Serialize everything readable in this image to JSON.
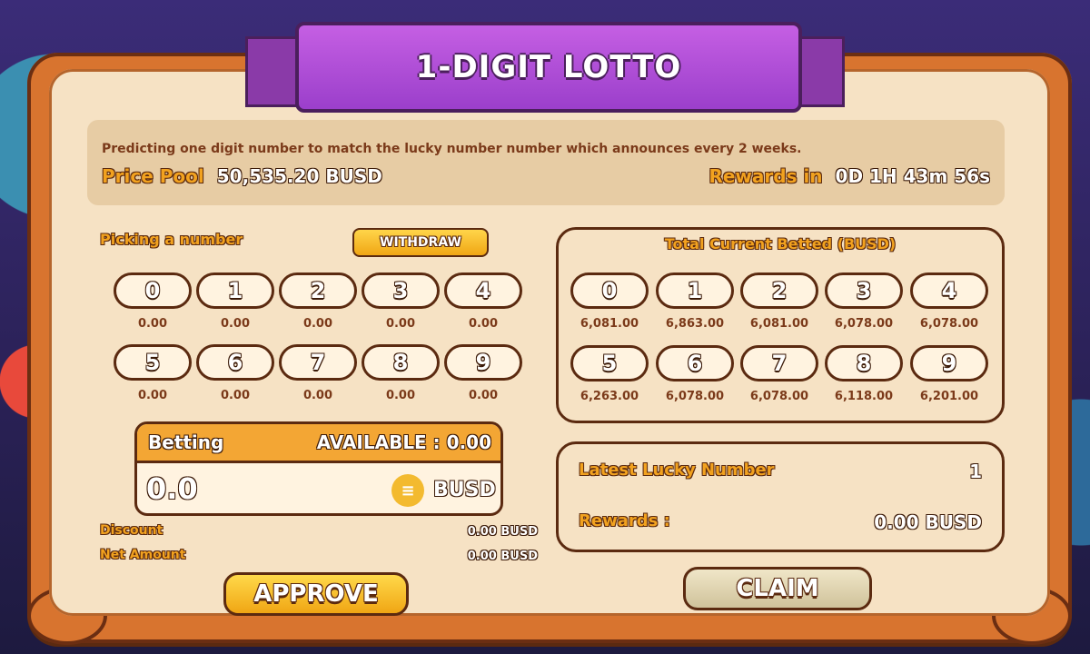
{
  "title": "1-DIGIT LOTTO",
  "info": {
    "description": "Predicting one digit number to match the lucky number number which announces every 2 weeks.",
    "price_pool_label": "Price Pool",
    "price_pool_value": "50,535.20 BUSD",
    "rewards_in_label": "Rewards in",
    "rewards_in_value": "0D 1H 43m 56s"
  },
  "picking": {
    "label": "Picking a number",
    "withdraw_label": "WITHDRAW",
    "numbers": [
      {
        "digit": "0",
        "value": "0.00"
      },
      {
        "digit": "1",
        "value": "0.00"
      },
      {
        "digit": "2",
        "value": "0.00"
      },
      {
        "digit": "3",
        "value": "0.00"
      },
      {
        "digit": "4",
        "value": "0.00"
      },
      {
        "digit": "5",
        "value": "0.00"
      },
      {
        "digit": "6",
        "value": "0.00"
      },
      {
        "digit": "7",
        "value": "0.00"
      },
      {
        "digit": "8",
        "value": "0.00"
      },
      {
        "digit": "9",
        "value": "0.00"
      }
    ]
  },
  "total": {
    "title": "Total Current Betted (BUSD)",
    "numbers": [
      {
        "digit": "0",
        "value": "6,081.00"
      },
      {
        "digit": "1",
        "value": "6,863.00"
      },
      {
        "digit": "2",
        "value": "6,081.00"
      },
      {
        "digit": "3",
        "value": "6,078.00"
      },
      {
        "digit": "4",
        "value": "6,078.00"
      },
      {
        "digit": "5",
        "value": "6,263.00"
      },
      {
        "digit": "6",
        "value": "6,078.00"
      },
      {
        "digit": "7",
        "value": "6,078.00"
      },
      {
        "digit": "8",
        "value": "6,118.00"
      },
      {
        "digit": "9",
        "value": "6,201.00"
      }
    ]
  },
  "betting": {
    "label": "Betting",
    "available": "AVAILABLE : 0.00",
    "amount": "0.0",
    "currency": "BUSD",
    "coin_icon": "busd-coin-icon"
  },
  "summary": {
    "discount_label": "Discount",
    "discount_value": "0.00 BUSD",
    "net_label": "Net Amount",
    "net_value": "0.00 BUSD"
  },
  "lucky": {
    "latest_label": "Latest Lucky Number",
    "latest_value": "1",
    "rewards_label": "Rewards :",
    "rewards_value": "0.00 BUSD"
  },
  "buttons": {
    "approve": "APPROVE",
    "claim": "CLAIM"
  },
  "colors": {
    "frame": "#d8742f",
    "paper": "#f6e2c4",
    "accent": "#f2a21f",
    "ribbon": "#a94fd3"
  }
}
